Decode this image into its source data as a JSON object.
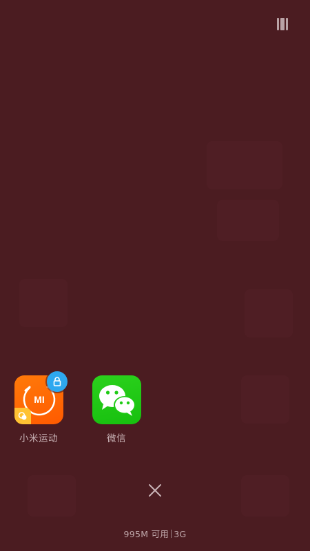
{
  "recents": {
    "apps": [
      {
        "label": "小米运动",
        "icon": "mi-fit-icon",
        "locked": true,
        "color": "#ff6c00"
      },
      {
        "label": "微信",
        "icon": "wechat-icon",
        "locked": false,
        "color": "#1ecb14"
      }
    ]
  },
  "status": {
    "memory": "995M 可用",
    "network": "3G"
  },
  "icons": {
    "view_toggle": "view-toggle-icon",
    "close": "close-icon",
    "lock": "lock-icon"
  },
  "colors": {
    "background": "#4b1c21",
    "lock_badge": "#2ea8f0",
    "text": "#c8b2b5"
  }
}
